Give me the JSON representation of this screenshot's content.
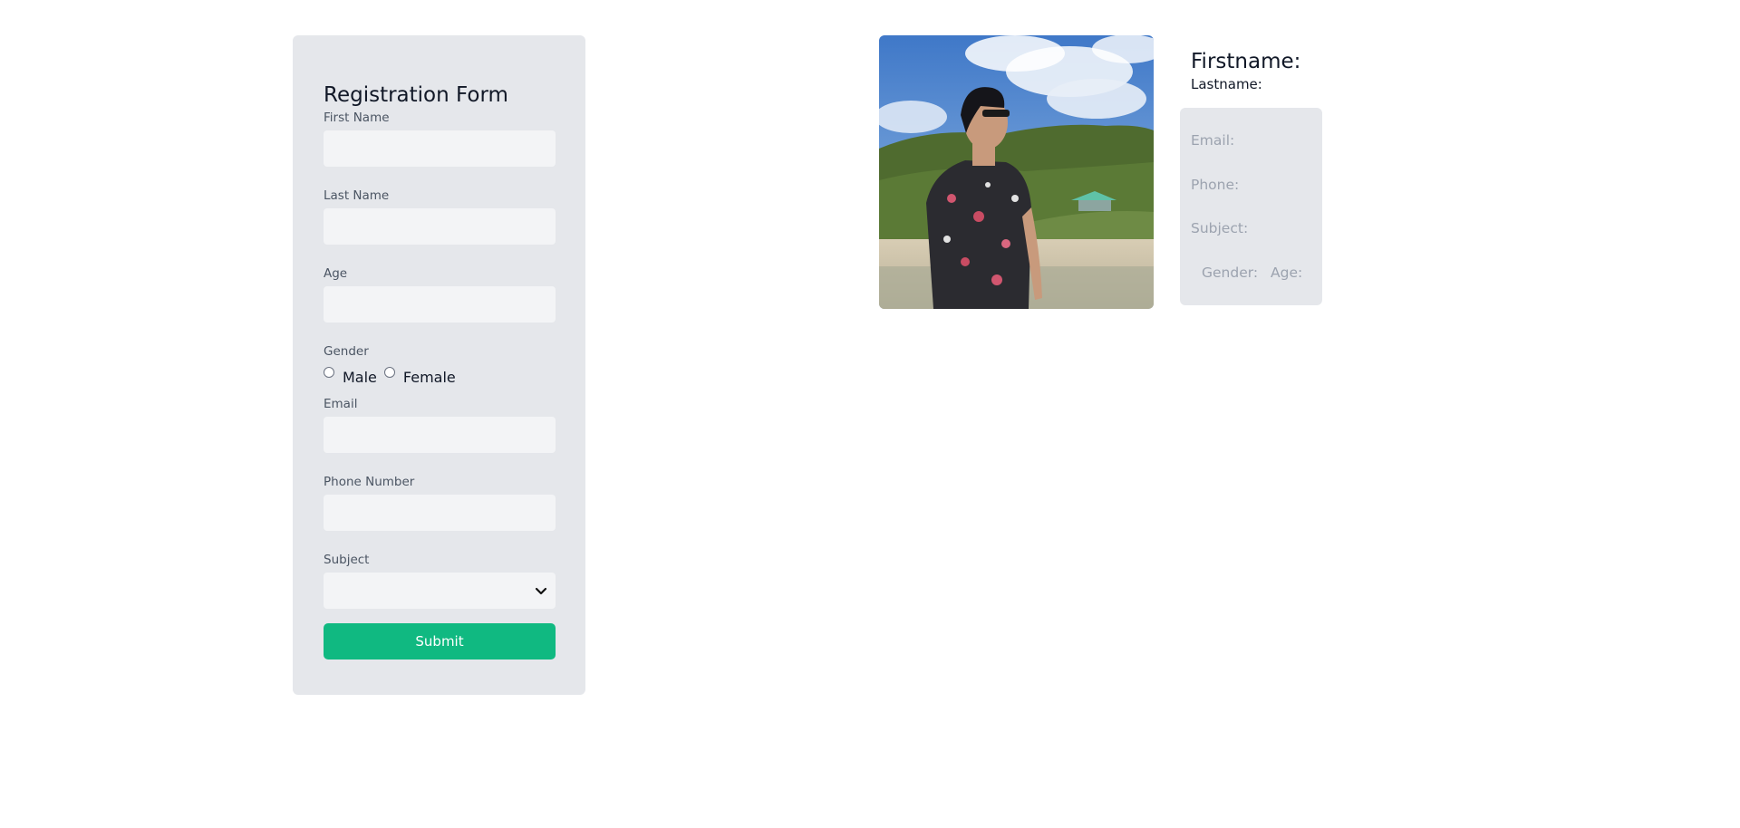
{
  "form": {
    "title": "Registration Form",
    "first_name_label": "First Name",
    "first_name_value": "",
    "last_name_label": "Last Name",
    "last_name_value": "",
    "age_label": "Age",
    "age_value": "",
    "gender_label": "Gender",
    "gender_options": [
      "Male",
      "Female"
    ],
    "email_label": "Email",
    "email_value": "",
    "phone_label": "Phone Number",
    "phone_value": "",
    "subject_label": "Subject",
    "subject_selected": "",
    "submit_label": "Submit",
    "submit_color": "#10b981"
  },
  "preview": {
    "firstname_label": "Firstname:",
    "lastname_label": "Lastname:",
    "email_label": "Email:",
    "phone_label": "Phone:",
    "subject_label": "Subject:",
    "gender_label": "Gender:",
    "age_label": "Age:"
  },
  "icons": {
    "subject_dropdown": "chevron-down-icon"
  }
}
